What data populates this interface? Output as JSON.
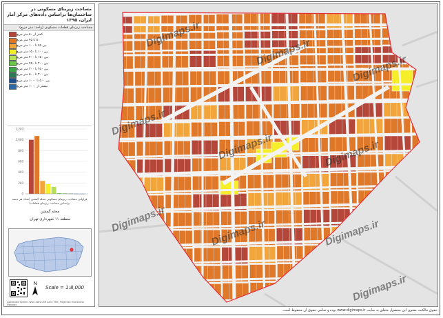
{
  "sidebar": {
    "title": "مساحت زیربنای مسکونی در ساختمان‌ها براساس داده‌های مرکز آمار ایران، ۱۳۹۵",
    "legend_title": "مساحت زیربنای قطعات مسکونی (واحد: متر مربع)",
    "legend": [
      {
        "label": "کمتر از ۵۰ متر مربع",
        "color": "#b5473a"
      },
      {
        "label": "۵۰ تا ۷۵ متر مربع",
        "color": "#e0782a"
      },
      {
        "label": "بین ۷۵ تا ۱۰۰ متر مربع",
        "color": "#f2a53a"
      },
      {
        "label": "بین ۱۰۰ تا ۱۵۰ متر مربع",
        "color": "#f7ee2a"
      },
      {
        "label": "بین ۱۵۰ تا ۲۰۰ متر مربع",
        "color": "#b6e05a"
      },
      {
        "label": "بین ۲۰۰ تا ۲۵۰ متر مربع",
        "color": "#6bc94a"
      },
      {
        "label": "بین ۲۵۰ تا ۳۰۰ متر مربع",
        "color": "#3aa64a"
      },
      {
        "label": "بین ۳۰۰ تا ۵۰۰ متر مربع",
        "color": "#2a7a55"
      },
      {
        "label": "بین ۵۰۰ تا ۱۰۰۰ متر مربع",
        "color": "#1f4f8a"
      },
      {
        "label": "بیشتر از ۱۰۰۰ متر مربع",
        "color": "#2a6aa8"
      }
    ],
    "chart_caption": "فراوانی مساحت زیربنای مسکونی محله گمشن (تعداد هر دسته براساس مساحت زیربنای قطعات)",
    "neighborhood_label": "محله گمشن",
    "district_label": "منطقه ۱۱ شهرداری تهران",
    "scale": "Scale = 1:8,000",
    "north_letter": "N",
    "small_print": "Coordinate System: WGS 1984 UTM Zone 39N | Projection: Transverse Mercator"
  },
  "chart_data": {
    "type": "bar",
    "categories": [
      "<50",
      "50-75",
      "75-100",
      "100-150",
      "150-200",
      "200-250",
      "250-300",
      "300-500",
      "500-1000",
      ">1000"
    ],
    "values": [
      1000,
      1070,
      240,
      180,
      130,
      12,
      8,
      5,
      3,
      2
    ],
    "colors": [
      "#b5473a",
      "#e0782a",
      "#f2a53a",
      "#f7ee2a",
      "#b6e05a",
      "#6bc94a",
      "#3aa64a",
      "#2a7a55",
      "#1f4f8a",
      "#2a6aa8"
    ],
    "ylim": [
      0,
      1200
    ],
    "grid": true
  },
  "map": {
    "watermark": "Digimaps.ir",
    "boundary_color": "#e6303a"
  },
  "footer": {
    "text": "حقوق مالکیت معنوی این محصول متعلق به سایت www.digimaps.ir بوده و تمامی حقوق آن محفوظ است."
  }
}
